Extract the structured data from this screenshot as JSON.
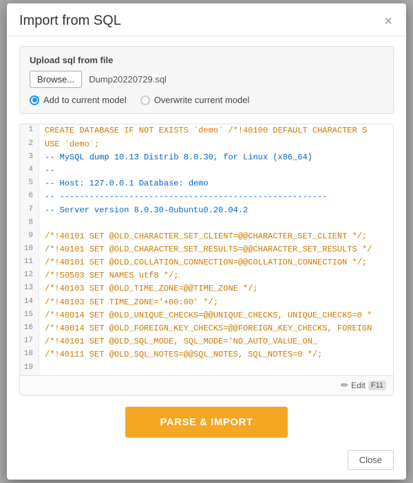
{
  "dialog": {
    "title": "Import from SQL",
    "close_x": "×"
  },
  "upload": {
    "label": "Upload sql from file",
    "browse_label": "Browse...",
    "file_name": "Dump20220729.sql",
    "options": [
      {
        "id": "add",
        "label": "Add to current model",
        "selected": true
      },
      {
        "id": "overwrite",
        "label": "Overwrite current model",
        "selected": false
      }
    ]
  },
  "code": {
    "lines": [
      {
        "num": "1",
        "text": "CREATE DATABASE  IF NOT EXISTS `demo`  /*!40100 DEFAULT CHARACTER S",
        "style": "orange"
      },
      {
        "num": "2",
        "text": "USE `demo`;",
        "style": "orange"
      },
      {
        "num": "3",
        "text": "-- MySQL dump 10.13  Distrib 8.0.30, for Linux (x86_64)",
        "style": "blue"
      },
      {
        "num": "4",
        "text": "--",
        "style": "blue"
      },
      {
        "num": "5",
        "text": "-- Host: 127.0.0.1    Database: demo",
        "style": "blue"
      },
      {
        "num": "6",
        "text": "-- ------------------------------------------------------",
        "style": "blue"
      },
      {
        "num": "7",
        "text": "-- Server version  8.0.30-0ubuntu0.20.04.2",
        "style": "blue"
      },
      {
        "num": "8",
        "text": "",
        "style": "orange"
      },
      {
        "num": "9",
        "text": "/*!40101 SET @OLD_CHARACTER_SET_CLIENT=@@CHARACTER_SET_CLIENT */;",
        "style": "orange"
      },
      {
        "num": "10",
        "text": "/*!40101 SET @OLD_CHARACTER_SET_RESULTS=@@CHARACTER_SET_RESULTS */",
        "style": "orange"
      },
      {
        "num": "11",
        "text": "/*!40101 SET @OLD_COLLATION_CONNECTION=@@COLLATION_CONNECTION */;",
        "style": "orange"
      },
      {
        "num": "12",
        "text": "/*!50503 SET NAMES utf8 */;",
        "style": "orange"
      },
      {
        "num": "13",
        "text": "/*!40103 SET @OLD_TIME_ZONE=@@TIME_ZONE */;",
        "style": "orange"
      },
      {
        "num": "14",
        "text": "/*!40103 SET TIME_ZONE='+00:00' */;",
        "style": "orange"
      },
      {
        "num": "15",
        "text": "/*!40014 SET @OLD_UNIQUE_CHECKS=@@UNIQUE_CHECKS, UNIQUE_CHECKS=0 *",
        "style": "orange"
      },
      {
        "num": "16",
        "text": "/*!40014 SET @OLD_FOREIGN_KEY_CHECKS=@@FOREIGN_KEY_CHECKS, FOREIGN",
        "style": "orange"
      },
      {
        "num": "17",
        "text": "/*!40101 SET @OLD_SQL_MODE, SQL_MODE='NO_AUTO_VALUE_ON_",
        "style": "orange"
      },
      {
        "num": "18",
        "text": "/*!40111 SET @OLD_SQL_NOTES=@@SQL_NOTES, SQL_NOTES=0 */;",
        "style": "orange"
      },
      {
        "num": "19",
        "text": "",
        "style": "orange"
      }
    ],
    "edit_label": "Edit",
    "edit_shortcut": "F11"
  },
  "actions": {
    "parse_label": "PARSE & IMPORT",
    "close_label": "Close"
  }
}
